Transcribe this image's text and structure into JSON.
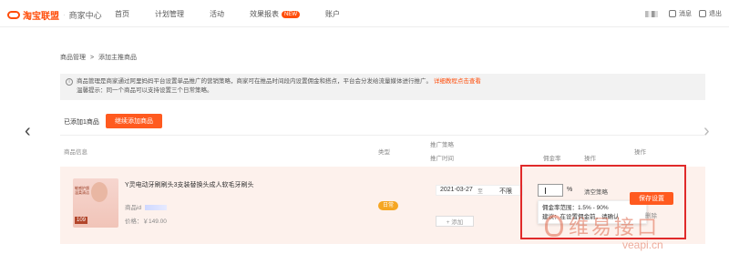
{
  "nav": {
    "brand": "淘宝联盟",
    "subbrand": "商家中心",
    "items": [
      "首页",
      "计划管理",
      "活动",
      "效果报表",
      "账户"
    ],
    "new_badge": "NEW",
    "message_label": "消息",
    "logout_label": "退出"
  },
  "breadcrumb": [
    "商品管理",
    ">",
    "添加主推商品"
  ],
  "notice": {
    "line1": "商品管理是商家通过阿里妈妈平台设置单品推广的营销策略，商家可在推品时间段内设置佣金和搭点，平台会分发给流量媒体进行推广。",
    "link": "详细教程点击查看",
    "line2": "温馨提示：同一个商品可以支持设置三个日常策略。"
  },
  "added_text": "已添加1商品",
  "continue_button": "继续添加商品",
  "headers": {
    "product": "商品信息",
    "type": "类型",
    "strategy": "推广策略",
    "time": "推广时间",
    "rate": "佣金率",
    "op": "操作",
    "op2": "操作"
  },
  "product": {
    "title": "Y灵电动牙刷刷头3支装替换头成人软毛牙刷头",
    "id_label": "商品id",
    "price": "价格：￥149.00",
    "thumb_num": "109",
    "thumb_text": "敏感护龈 温柔清洁"
  },
  "type_tag": "日常",
  "start_date": "2021-03-27",
  "date_sep": "至",
  "end_date": "不限",
  "add_button": "+ 添加",
  "percent": "%",
  "clear_plan": "清空策略",
  "tooltip": {
    "line1": "佣金率范围：1.5% - 90%",
    "line2": "建议：在设置佣金前，请确认"
  },
  "save_button": "保存设置",
  "delete_link": "删除",
  "watermark": {
    "text": "维易接口",
    "url": "veapi.cn"
  }
}
